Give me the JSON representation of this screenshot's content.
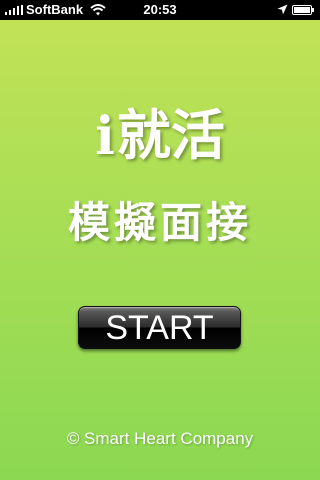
{
  "status_bar": {
    "carrier": "SoftBank",
    "time": "20:53",
    "icons": [
      "signal-icon",
      "wifi-icon",
      "location-arrow-icon",
      "battery-icon"
    ]
  },
  "app": {
    "title_prefix": "i",
    "title_main": "就活",
    "subtitle": "模擬面接",
    "start_label": "START",
    "copyright": "© Smart Heart Company"
  },
  "colors": {
    "background_top": "#c2e256",
    "background_bottom": "#8cd852",
    "text": "#ffffff",
    "button": "#000000"
  }
}
